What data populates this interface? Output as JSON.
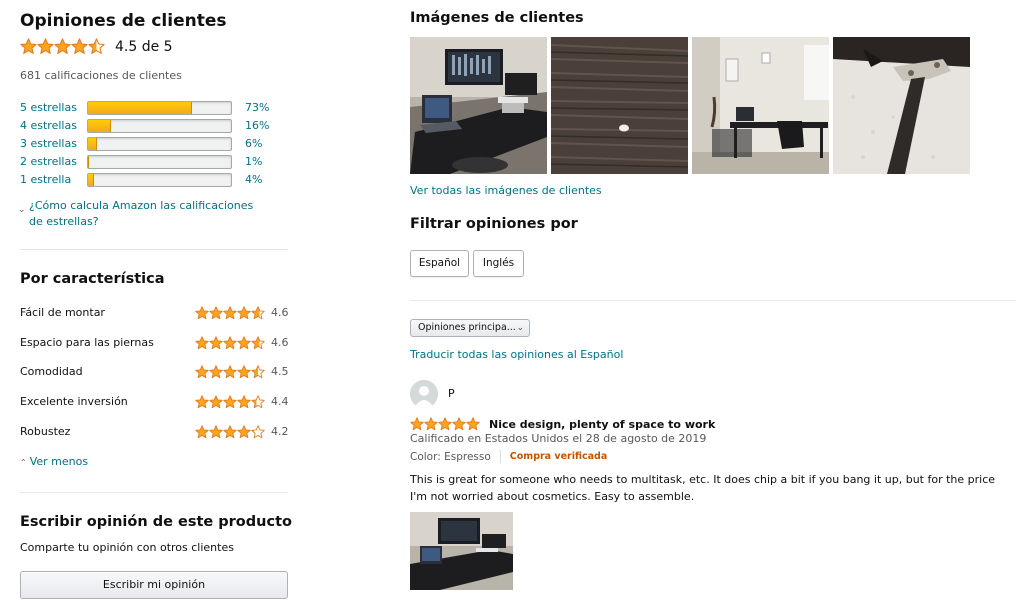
{
  "ratings": {
    "title": "Opiniones de clientes",
    "overall_value": "4.5 de 5",
    "overall_stars": 4.5,
    "total": "681 calificaciones de clientes",
    "histogram": [
      {
        "label": "5 estrellas",
        "percent_text": "73%",
        "percent": 73
      },
      {
        "label": "4 estrellas",
        "percent_text": "16%",
        "percent": 16
      },
      {
        "label": "3 estrellas",
        "percent_text": "6%",
        "percent": 6
      },
      {
        "label": "2 estrellas",
        "percent_text": "1%",
        "percent": 1
      },
      {
        "label": "1 estrella",
        "percent_text": "4%",
        "percent": 4
      }
    ],
    "how_calculated": "¿Cómo calcula Amazon las calificaciones de estrellas?"
  },
  "features": {
    "title": "Por característica",
    "items": [
      {
        "name": "Fácil de montar",
        "value": "4.6",
        "stars": 4.6
      },
      {
        "name": "Espacio para las piernas",
        "value": "4.6",
        "stars": 4.6
      },
      {
        "name": "Comodidad",
        "value": "4.5",
        "stars": 4.5
      },
      {
        "name": "Excelente inversión",
        "value": "4.4",
        "stars": 4.4
      },
      {
        "name": "Robustez",
        "value": "4.2",
        "stars": 4.2
      }
    ],
    "see_less": "Ver menos"
  },
  "write_review": {
    "title": "Escribir opinión de este producto",
    "subtitle": "Comparte tu opinión con otros clientes",
    "button": "Escribir mi opinión"
  },
  "customer_images": {
    "title": "Imágenes de clientes",
    "see_all": "Ver todas las imágenes de clientes"
  },
  "filter": {
    "title": "Filtrar opiniones por",
    "chips": [
      "Español",
      "Inglés"
    ]
  },
  "sort": {
    "selected": "Opiniones principa..."
  },
  "translate_link": "Traducir todas las opiniones al Español",
  "review": {
    "author": "P",
    "stars": 5,
    "title": "Nice design, plenty of space to work",
    "meta": "Calificado en Estados Unidos el 28 de agosto de 2019",
    "color": "Color: Espresso",
    "verified": "Compra verificada",
    "body": "This is great for someone who needs to multitask, etc. It does chip a bit if you bang it up, but for the price I'm not worried about cosmetics. Easy to assemble."
  },
  "colors": {
    "star": "#ffa41c",
    "link": "#007185",
    "verified": "#c45500",
    "bar_fill": "#ffa41c"
  }
}
